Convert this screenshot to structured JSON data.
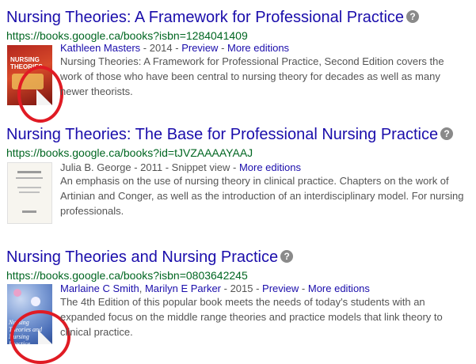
{
  "results": [
    {
      "title": "Nursing Theories: A Framework for Professional Practice",
      "url": "https://books.google.ca/books?isbn=1284041409",
      "authors": [
        "Kathleen Masters"
      ],
      "year_text": " - 2014 - ",
      "view_link": "Preview",
      "separator": " - ",
      "editions_link": "More editions",
      "snippet": "Nursing Theories: A Framework for Professional Practice, Second Edition covers the work of those who have been central to nursing theory for decades as well as many newer theorists.",
      "cover_text": "NURSING THEORIES"
    },
    {
      "title": "Nursing Theories: The Base for Professional Nursing Practice",
      "url": "https://books.google.ca/books?id=tJVZAAAAYAAJ",
      "authors": [
        "Julia B. George"
      ],
      "year_text": " - 2011 - Snippet view - ",
      "editions_link": "More editions",
      "snippet": "An emphasis on the use of nursing theory in clinical practice. Chapters on the work of Artinian and Conger, as well as the introduction of an interdisciplinary model. For nursing professionals."
    },
    {
      "title": "Nursing Theories and Nursing Practice",
      "url": "https://books.google.ca/books?isbn=0803642245",
      "authors": [
        "Marlaine C Smith",
        "Marilyn E Parker"
      ],
      "author_sep": ", ",
      "year_text": " - 2015 - ",
      "view_link": "Preview",
      "separator": " - ",
      "editions_link": "More editions",
      "snippet": "The 4th Edition of this popular book meets the needs of today's students with an expanded focus on the middle range theories and practice models that link theory to clinical practice.",
      "cover_text": "Nursing Theories and Nursing Practice"
    }
  ],
  "help_icon_glyph": "?",
  "colors": {
    "title": "#1a0dab",
    "url": "#006621",
    "text": "#545454",
    "annotation": "#e01b24"
  }
}
